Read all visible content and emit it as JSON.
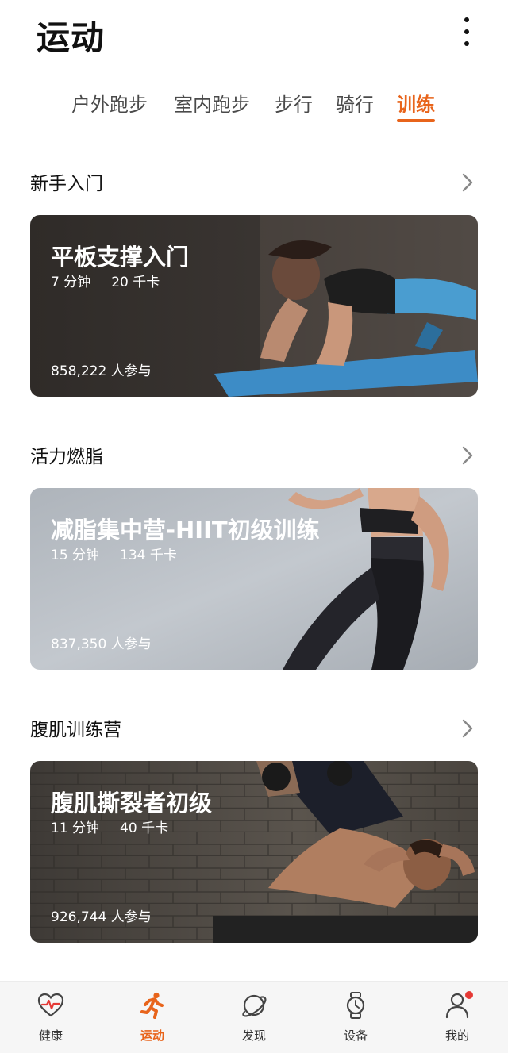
{
  "header": {
    "title": "运动"
  },
  "tabs": [
    {
      "label": "户外跑步",
      "active": false
    },
    {
      "label": "室内跑步",
      "active": false
    },
    {
      "label": "步行",
      "active": false
    },
    {
      "label": "骑行",
      "active": false
    },
    {
      "label": "训练",
      "active": true
    }
  ],
  "sections": [
    {
      "title": "新手入门",
      "card": {
        "title": "平板支撑入门",
        "duration": "7 分钟",
        "calories": "20 千卡",
        "participants": "858,222 人参与"
      }
    },
    {
      "title": "活力燃脂",
      "card": {
        "title": "减脂集中营-HIIT初级训练",
        "duration": "15 分钟",
        "calories": "134 千卡",
        "participants": "837,350 人参与"
      }
    },
    {
      "title": "腹肌训练营",
      "card": {
        "title": "腹肌撕裂者初级",
        "duration": "11 分钟",
        "calories": "40 千卡",
        "participants": "926,744 人参与"
      }
    }
  ],
  "bottom_nav": [
    {
      "label": "健康",
      "icon": "heart-pulse-icon",
      "active": false
    },
    {
      "label": "运动",
      "icon": "running-icon",
      "active": true
    },
    {
      "label": "发现",
      "icon": "planet-icon",
      "active": false
    },
    {
      "label": "设备",
      "icon": "watch-icon",
      "active": false
    },
    {
      "label": "我的",
      "icon": "profile-icon",
      "active": false,
      "badge": true
    }
  ],
  "colors": {
    "accent": "#e8641b",
    "badge": "#e53935"
  }
}
